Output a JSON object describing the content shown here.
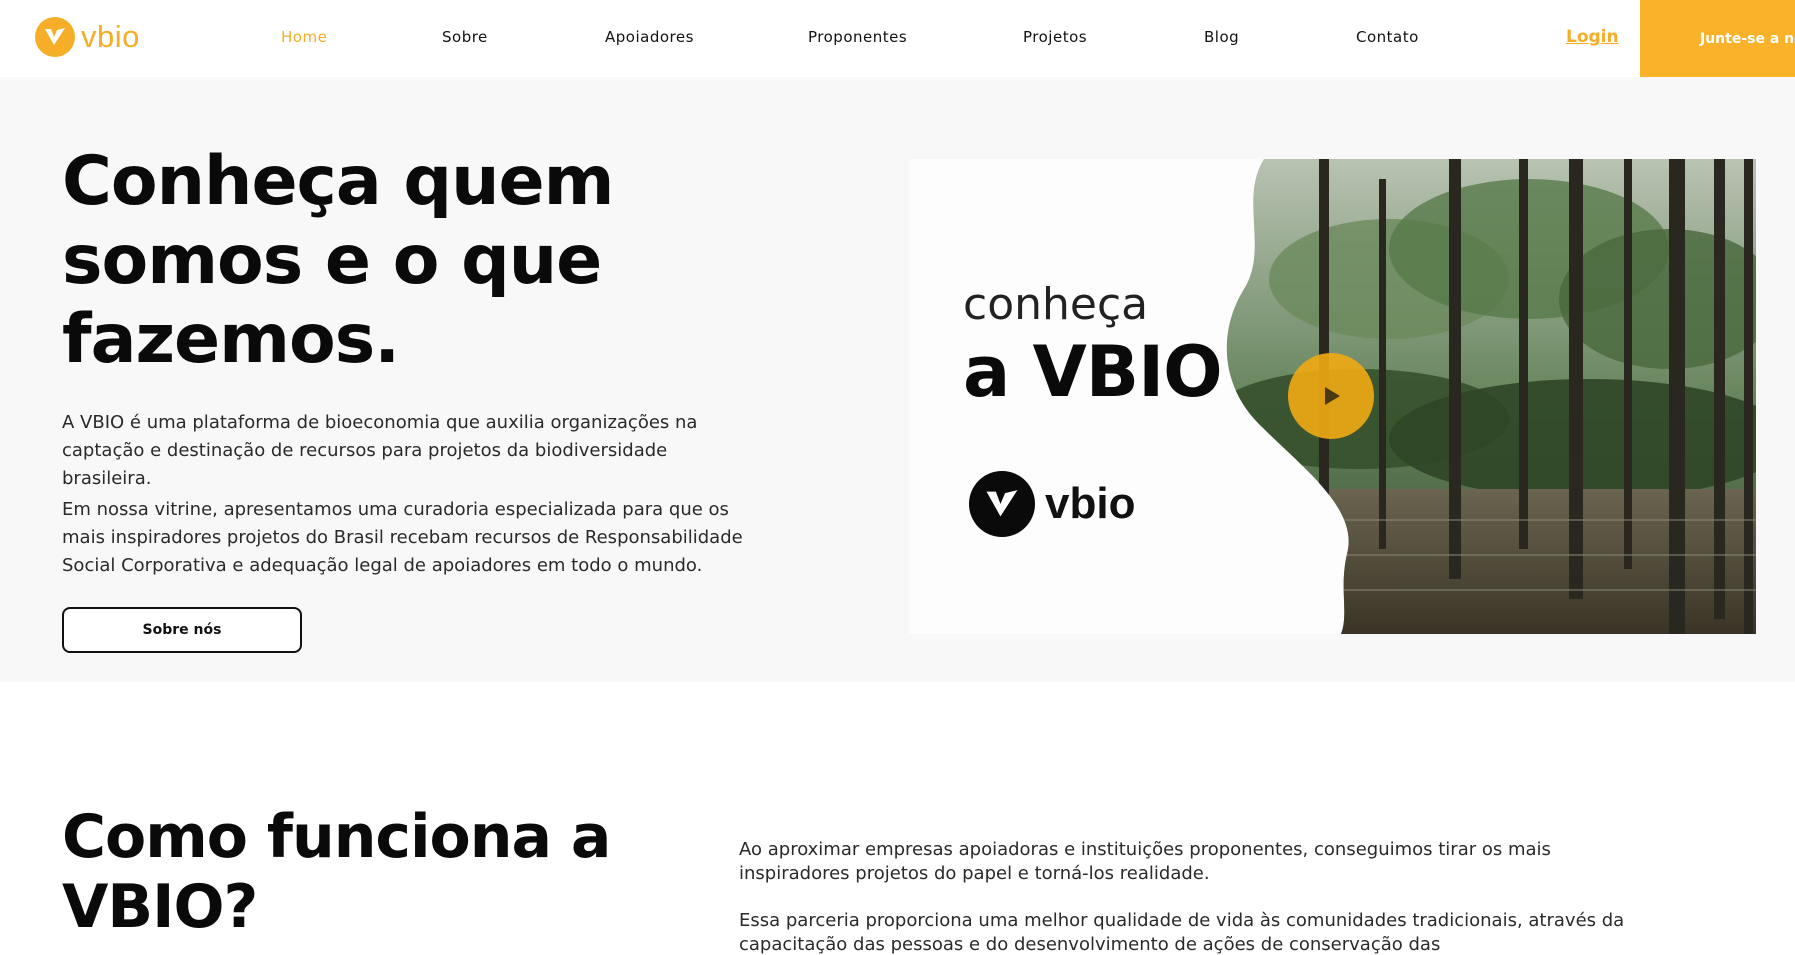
{
  "brand": {
    "name": "vbio",
    "accent": "#f6ad28"
  },
  "nav": {
    "items": [
      {
        "label": "Home",
        "active": true
      },
      {
        "label": "Sobre"
      },
      {
        "label": "Apoiadores"
      },
      {
        "label": "Proponentes"
      },
      {
        "label": "Projetos"
      },
      {
        "label": "Blog"
      },
      {
        "label": "Contato"
      }
    ],
    "login": "Login",
    "cta": "Junte-se a nós"
  },
  "hero": {
    "title": "Conheça quem somos e o que fazemos.",
    "paragraph1": "A VBIO é uma plataforma de bioeconomia que auxilia organizações na captação e destinação de recursos para projetos da biodiversidade brasileira.",
    "paragraph2": "Em nossa vitrine, apresentamos uma curadoria especializada para que os mais inspiradores projetos do Brasil recebam recursos de Responsabilidade Social Corporativa e adequação legal de apoiadores em todo o mundo.",
    "button": "Sobre nós"
  },
  "video": {
    "line1": "conheça",
    "line2": "a VBIO",
    "logo_text": "vbio",
    "play_icon": "play-icon"
  },
  "how": {
    "title": "Como funciona a VBIO?",
    "paragraph1": "Ao aproximar empresas apoiadoras e instituições proponentes, conseguimos tirar os mais inspiradores projetos do papel e torná-los realidade.",
    "paragraph2": "Essa parceria proporciona uma melhor qualidade de vida às comunidades tradicionais, através da capacitação das pessoas e do desenvolvimento de ações de conservação das"
  }
}
